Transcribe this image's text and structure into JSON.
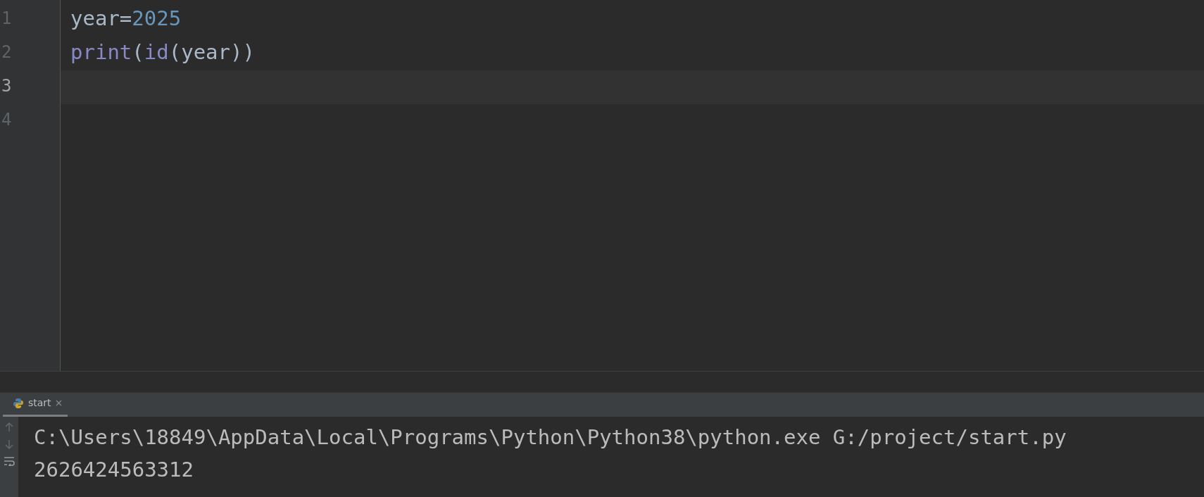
{
  "editor": {
    "lines": [
      {
        "number": "1",
        "current": false,
        "tokens": [
          {
            "kind": "identifier",
            "text": "year"
          },
          {
            "kind": "operator",
            "text": "="
          },
          {
            "kind": "number",
            "text": "2025"
          }
        ]
      },
      {
        "number": "2",
        "current": false,
        "tokens": [
          {
            "kind": "builtin",
            "text": "print"
          },
          {
            "kind": "paren",
            "text": "("
          },
          {
            "kind": "builtin",
            "text": "id"
          },
          {
            "kind": "paren",
            "text": "("
          },
          {
            "kind": "identifier",
            "text": "year"
          },
          {
            "kind": "paren",
            "text": "))"
          }
        ]
      },
      {
        "number": "3",
        "current": true
      },
      {
        "number": "4",
        "current": false
      }
    ]
  },
  "run_panel": {
    "tabs": [
      {
        "label": "start",
        "selected": true
      }
    ],
    "output": [
      "C:\\Users\\18849\\AppData\\Local\\Programs\\Python\\Python38\\python.exe G:/project/start.py",
      "2626424563312"
    ]
  }
}
